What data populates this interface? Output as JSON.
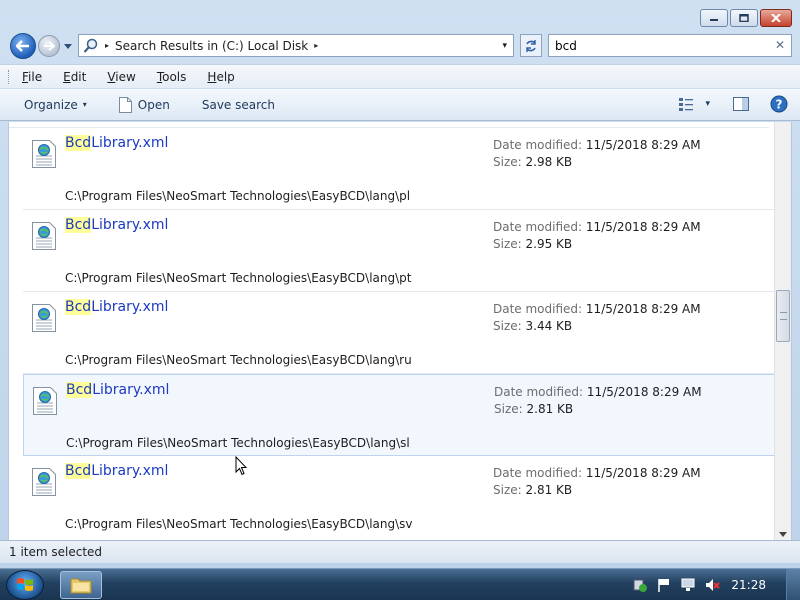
{
  "window": {
    "caption_buttons": [
      "minimize-icon",
      "maximize-icon",
      "close-icon"
    ]
  },
  "address_bar": {
    "separator": "▸",
    "crumb": "Search Results in (C:) Local Disk",
    "trailing_separator": "▸",
    "dropdown": "▾"
  },
  "search": {
    "query": "bcd",
    "clear": "✕"
  },
  "menu": {
    "items": [
      {
        "label": "File",
        "underline": "F",
        "rest": "ile"
      },
      {
        "label": "Edit",
        "underline": "E",
        "rest": "dit"
      },
      {
        "label": "View",
        "underline": "V",
        "rest": "iew"
      },
      {
        "label": "Tools",
        "underline": "T",
        "rest": "ools"
      },
      {
        "label": "Help",
        "underline": "H",
        "rest": "elp"
      }
    ]
  },
  "commands": {
    "organize": "Organize",
    "organize_arrow": "▾",
    "open": "Open",
    "save_search": "Save search",
    "views_arrow": "▾"
  },
  "results": [
    {
      "match": "Bcd",
      "rest": "Library.xml",
      "date_label": "Date modified:",
      "date": "11/5/2018 8:29 AM",
      "size_label": "Size:",
      "size": "2.98 KB",
      "path": "C:\\Program Files\\NeoSmart Technologies\\EasyBCD\\lang\\pl"
    },
    {
      "match": "Bcd",
      "rest": "Library.xml",
      "date_label": "Date modified:",
      "date": "11/5/2018 8:29 AM",
      "size_label": "Size:",
      "size": "2.95 KB",
      "path": "C:\\Program Files\\NeoSmart Technologies\\EasyBCD\\lang\\pt"
    },
    {
      "match": "Bcd",
      "rest": "Library.xml",
      "date_label": "Date modified:",
      "date": "11/5/2018 8:29 AM",
      "size_label": "Size:",
      "size": "3.44 KB",
      "path": "C:\\Program Files\\NeoSmart Technologies\\EasyBCD\\lang\\ru"
    },
    {
      "match": "Bcd",
      "rest": "Library.xml",
      "date_label": "Date modified:",
      "date": "11/5/2018 8:29 AM",
      "size_label": "Size:",
      "size": "2.81 KB",
      "path": "C:\\Program Files\\NeoSmart Technologies\\EasyBCD\\lang\\sl",
      "selected": true
    },
    {
      "match": "Bcd",
      "rest": "Library.xml",
      "date_label": "Date modified:",
      "date": "11/5/2018 8:29 AM",
      "size_label": "Size:",
      "size": "2.81 KB",
      "path": "C:\\Program Files\\NeoSmart Technologies\\EasyBCD\\lang\\sv"
    }
  ],
  "status": {
    "text": "1 item selected"
  },
  "taskbar": {
    "clock": "21:28",
    "tray_icons": [
      "action-center-icon",
      "flag-icon",
      "network-icon",
      "volume-muted-icon"
    ]
  },
  "colors": {
    "link": "#1d3ac2",
    "highlight": "#ffff99",
    "selection": "#f2f7fd"
  }
}
